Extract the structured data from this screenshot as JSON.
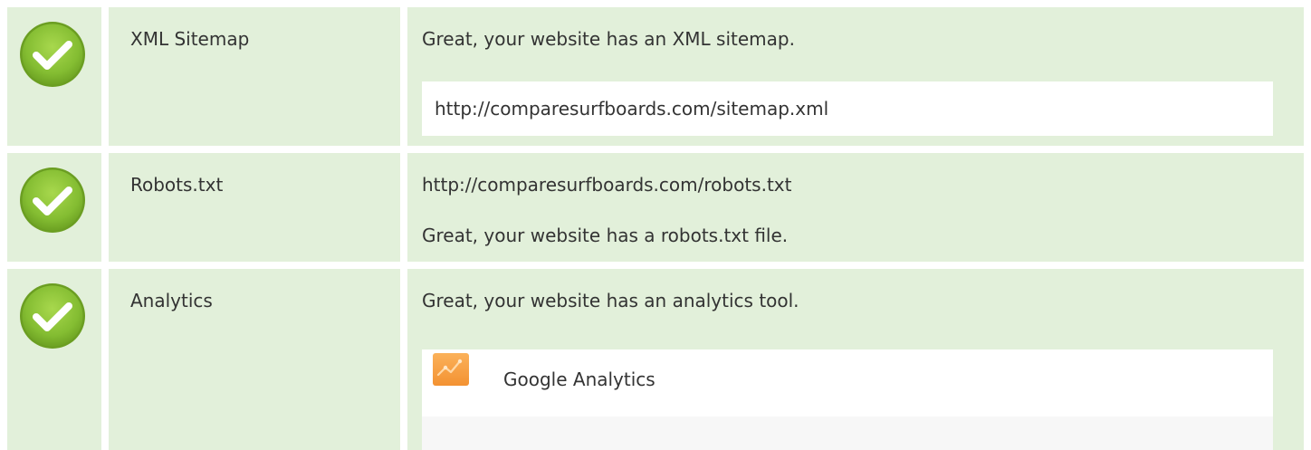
{
  "rows": [
    {
      "name": "XML Sitemap",
      "status": "pass",
      "message": "Great, your website has an XML sitemap.",
      "detail": "http://comparesurfboards.com/sitemap.xml"
    },
    {
      "name": "Robots.txt",
      "status": "pass",
      "url": "http://comparesurfboards.com/robots.txt",
      "message": "Great, your website has a robots.txt file."
    },
    {
      "name": "Analytics",
      "status": "pass",
      "message": "Great, your website has an analytics tool.",
      "tool": {
        "icon": "google-analytics-icon",
        "name": "Google Analytics"
      }
    }
  ],
  "colors": {
    "row_background": "#e2f0da",
    "check_green": "#8cc63f",
    "ga_orange": "#f7a043"
  }
}
